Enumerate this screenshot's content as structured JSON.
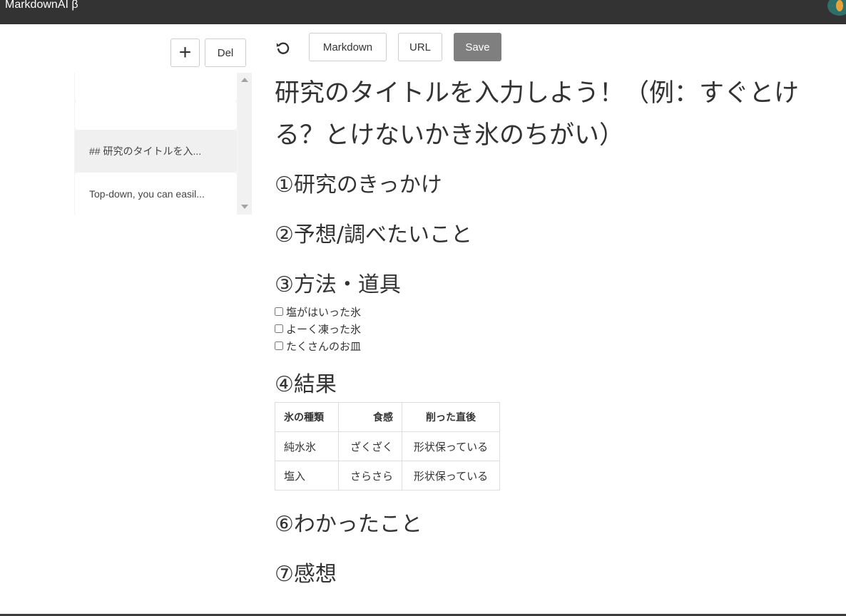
{
  "app": {
    "title": "MarkdownAI β"
  },
  "sidebar": {
    "add_label": "+",
    "delete_label": "Del",
    "items": [
      {
        "label": ""
      },
      {
        "label": ""
      },
      {
        "label": "## 研究のタイトルを入..."
      },
      {
        "label": "Top-down, you can easil..."
      }
    ]
  },
  "toolbar": {
    "undo_icon": "undo-icon",
    "markdown_label": "Markdown",
    "url_label": "URL",
    "save_label": "Save"
  },
  "document": {
    "title": "研究のタイトルを入力しよう！（例：すぐとける？とけないかき氷のちがい）",
    "headings": {
      "h1": "①研究のきっかけ",
      "h2": "②予想/調べたいこと",
      "h3": "③方法・道具",
      "h4": "④結果",
      "h6": "⑥わかったこと",
      "h7": "⑦感想"
    },
    "checklist": [
      {
        "label": "塩がはいった氷",
        "checked": false
      },
      {
        "label": "よーく凍った氷",
        "checked": false
      },
      {
        "label": "たくさんのお皿",
        "checked": false
      }
    ],
    "table": {
      "headers": [
        "氷の種類",
        "食感",
        "削った直後"
      ],
      "rows": [
        [
          "純水氷",
          "ざくざく",
          "形状保っている"
        ],
        [
          "塩入",
          "さらさら",
          "形状保っている"
        ]
      ]
    }
  }
}
